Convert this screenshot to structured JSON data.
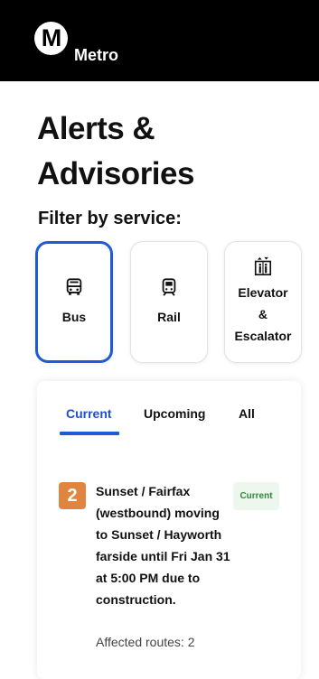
{
  "header": {
    "logo_letter": "M",
    "brand": "Metro",
    "background": "#000000"
  },
  "page": {
    "title": "Alerts & Advisories",
    "filter_label": "Filter by service:"
  },
  "services": [
    {
      "label": "Bus",
      "icon": "bus-icon",
      "selected": true
    },
    {
      "label": "Rail",
      "icon": "train-icon",
      "selected": false
    },
    {
      "label": "Elevator\n&\nEscalator",
      "lines": [
        "Elevator",
        "&",
        "Escalator"
      ],
      "icon": "elevator-escalator-icon",
      "selected": false
    }
  ],
  "tabs": [
    {
      "label": "Current",
      "active": true
    },
    {
      "label": "Upcoming",
      "active": false
    },
    {
      "label": "All",
      "active": false
    }
  ],
  "alerts": [
    {
      "line_number": "2",
      "line_color": "#e0853f",
      "description": "Sunset / Fairfax (westbound) moving to Sunset / Hayworth farside until Fri Jan 31 at 5:00 PM due to construction.",
      "affected_routes": "Affected routes: 2",
      "status": "Current",
      "status_color": "#2f8a3a"
    }
  ],
  "colors": {
    "accent": "#1f5bd8",
    "active_tab_text": "#1f4fc9"
  }
}
